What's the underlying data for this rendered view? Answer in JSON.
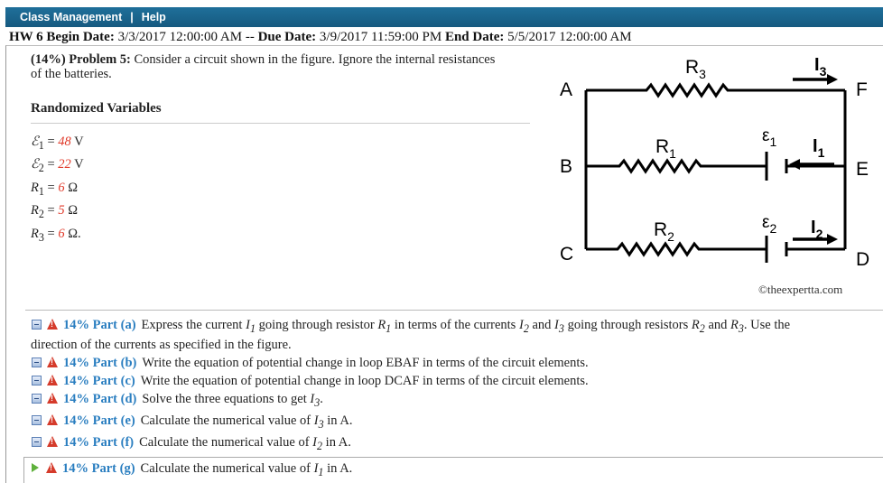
{
  "nav": {
    "class_management": "Class Management",
    "separator": "|",
    "help": "Help"
  },
  "hw": {
    "name": "HW 6",
    "begin_label": "Begin Date:",
    "begin_value": "3/3/2017 12:00:00 AM",
    "dash": "--",
    "due_label": "Due Date:",
    "due_value": "3/9/2017 11:59:00 PM",
    "end_label": "End Date:",
    "end_value": "5/5/2017 12:00:00 AM"
  },
  "problem": {
    "header": "(14%) Problem 5:",
    "text": "Consider a circuit shown in the figure. Ignore the internal resistances of the batteries."
  },
  "randomized": {
    "title": "Randomized Variables",
    "vars": [
      {
        "symbol": "ℰ",
        "sub": "1",
        "value": "48",
        "unit": "V"
      },
      {
        "symbol": "ℰ",
        "sub": "2",
        "value": "22",
        "unit": "V"
      },
      {
        "symbol": "R",
        "sub": "1",
        "value": "6",
        "unit": "Ω"
      },
      {
        "symbol": "R",
        "sub": "2",
        "value": "5",
        "unit": "Ω"
      },
      {
        "symbol": "R",
        "sub": "3",
        "value": "6",
        "unit": "Ω."
      }
    ]
  },
  "circuit": {
    "nodes": [
      "A",
      "B",
      "C",
      "D",
      "E",
      "F"
    ],
    "resistors": [
      "R3",
      "R1",
      "R2"
    ],
    "currents": [
      "I3",
      "I1",
      "I2"
    ],
    "emfs": [
      "ε1",
      "ε2"
    ],
    "credit": "©theexpertta.com"
  },
  "parts": [
    {
      "label": "14% Part (a)",
      "text": "Express the current I1 going through resistor R1 in terms of the currents I2 and I3 going through resistors R2 and R3. Use the direction of the currents as specified in the figure."
    },
    {
      "label": "14% Part (b)",
      "text": "Write the equation of potential change in loop EBAF in terms of the circuit elements."
    },
    {
      "label": "14% Part (c)",
      "text": "Write the equation of potential change in loop DCAF in terms of the circuit elements."
    },
    {
      "label": "14% Part (d)",
      "text": "Solve the three equations to get I3."
    },
    {
      "label": "14% Part (e)",
      "text": "Calculate the numerical value of I3 in A."
    },
    {
      "label": "14% Part (f)",
      "text": "Calculate the numerical value of I2 in A."
    },
    {
      "label": "14% Part (g)",
      "text": "Calculate the numerical value of I1 in A."
    }
  ]
}
